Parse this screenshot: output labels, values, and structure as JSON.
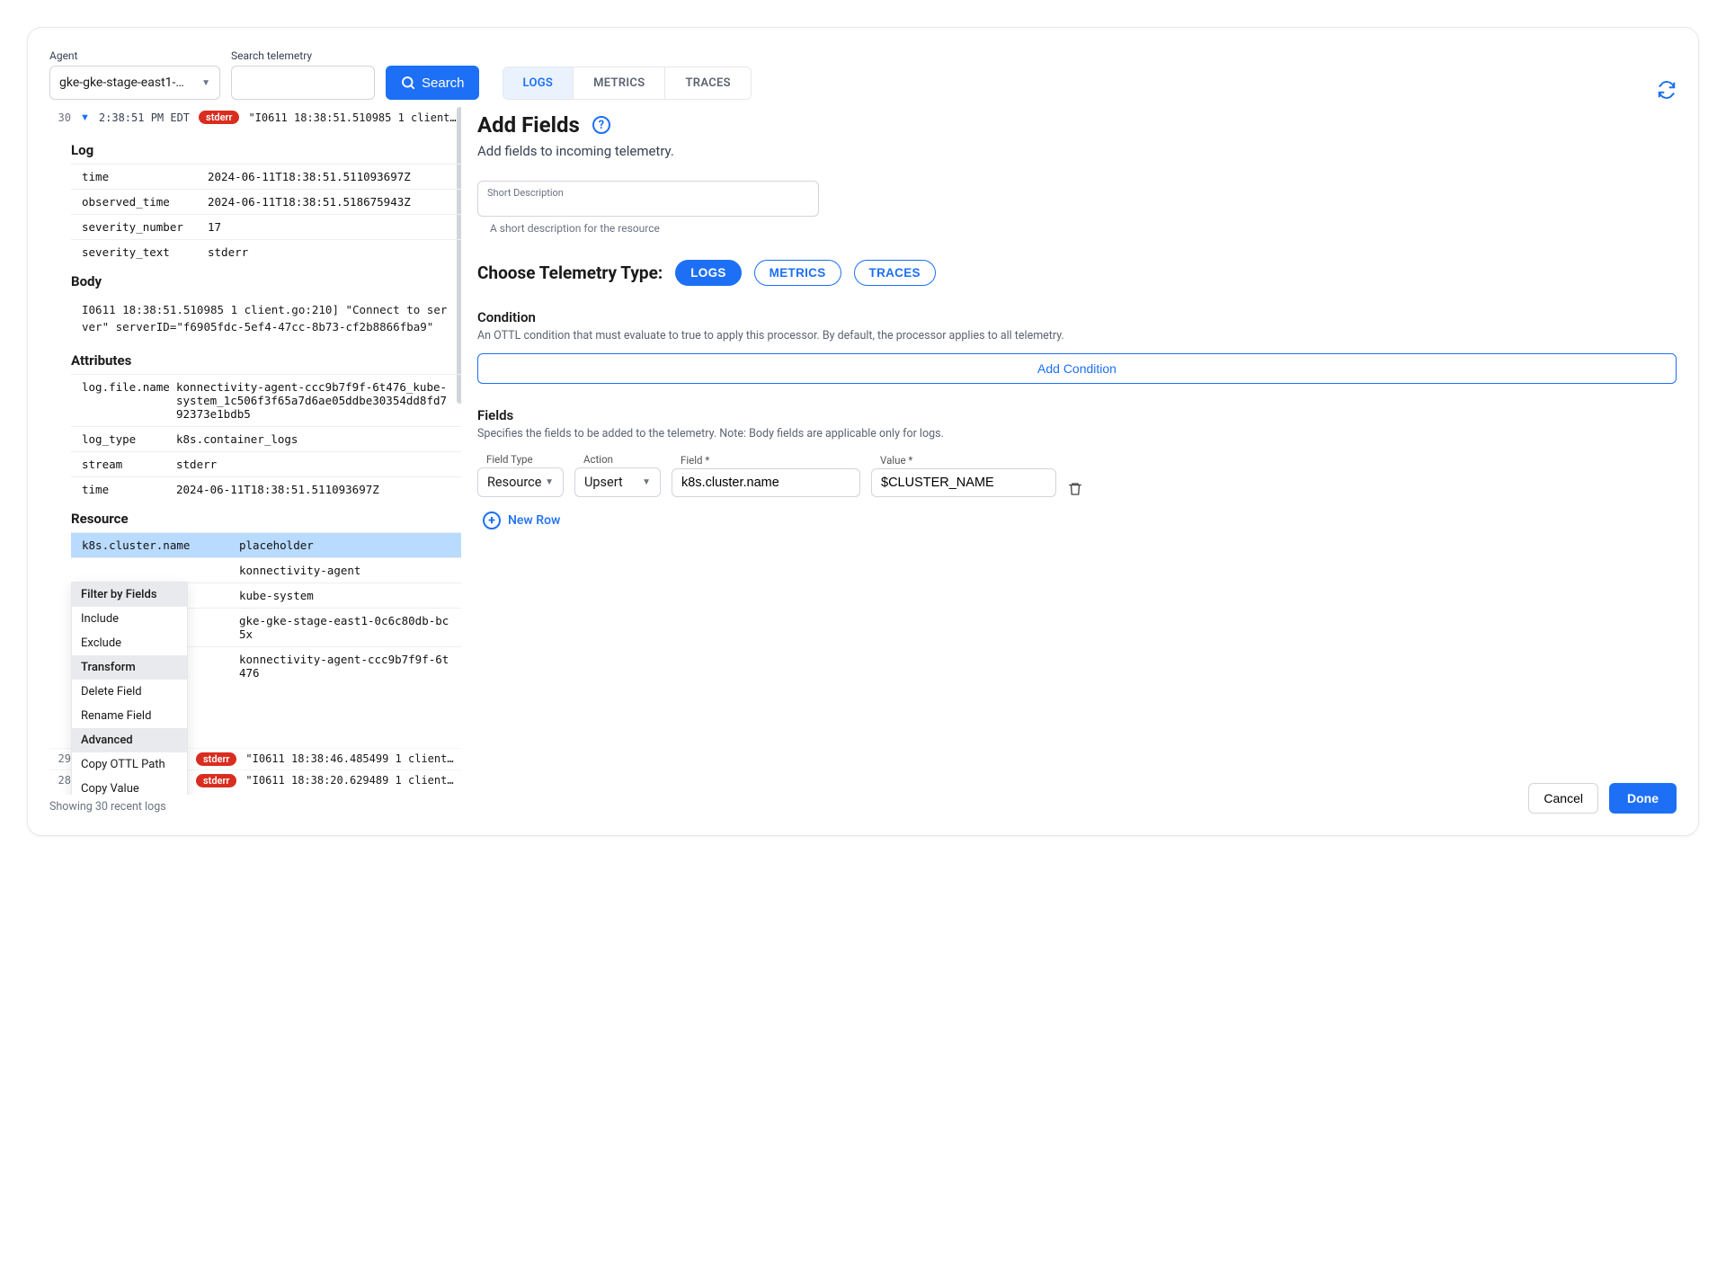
{
  "topbar": {
    "agent_label": "Agent",
    "agent_value": "gke-gke-stage-east1-…",
    "search_label": "Search telemetry",
    "search_value": "",
    "search_button": "Search",
    "tabs": {
      "logs": "LOGS",
      "metrics": "METRICS",
      "traces": "TRACES"
    }
  },
  "log_entry": {
    "index": "30",
    "timestamp": "2:38:51 PM EDT",
    "severity_pill": "stderr",
    "summary": "\"I0611 18:38:51.510985 1 client…",
    "sections": {
      "log_heading": "Log",
      "log": [
        {
          "k": "time",
          "v": "2024-06-11T18:38:51.511093697Z"
        },
        {
          "k": "observed_time",
          "v": "2024-06-11T18:38:51.518675943Z"
        },
        {
          "k": "severity_number",
          "v": "17"
        },
        {
          "k": "severity_text",
          "v": "stderr"
        }
      ],
      "body_heading": "Body",
      "body": "I0611 18:38:51.510985       1 client.go:210] \"Connect to server\" serverID=\"f6905fdc-5ef4-47cc-8b73-cf2b8866fba9\"",
      "attributes_heading": "Attributes",
      "attributes": [
        {
          "k": "log.file.name",
          "v": "konnectivity-agent-ccc9b7f9f-6t476_kube-system_1c506f3f65a7d6ae05ddbe30354dd8fd792373e1bdb5"
        },
        {
          "k": "log_type",
          "v": "k8s.container_logs"
        },
        {
          "k": "stream",
          "v": "stderr"
        },
        {
          "k": "time",
          "v": "2024-06-11T18:38:51.511093697Z"
        }
      ],
      "resource_heading": "Resource",
      "resource": [
        {
          "k": "k8s.cluster.name",
          "v": "placeholder",
          "highlight": true
        },
        {
          "k": "",
          "v": "konnectivity-agent"
        },
        {
          "k": "",
          "v": "kube-system"
        },
        {
          "k": "",
          "v": "gke-gke-stage-east1-0c6c80db-bc5x"
        },
        {
          "k": "",
          "v": "konnectivity-agent-ccc9b7f9f-6t476"
        }
      ]
    }
  },
  "context_menu": {
    "filter_heading": "Filter by Fields",
    "include": "Include",
    "exclude": "Exclude",
    "transform_heading": "Transform",
    "delete_field": "Delete Field",
    "rename_field": "Rename Field",
    "advanced_heading": "Advanced",
    "copy_ottl": "Copy OTTL Path",
    "copy_value": "Copy Value"
  },
  "collapsed_rows": [
    {
      "idx": "29",
      "pill": "stderr",
      "summary": "\"I0611 18:38:46.485499 1 client…"
    },
    {
      "idx": "28",
      "pill": "stderr",
      "summary": "\"I0611 18:38:20.629489 1 client…"
    }
  ],
  "status_bar": "Showing 30 recent logs",
  "right": {
    "title": "Add Fields",
    "subtitle": "Add fields to incoming telemetry.",
    "short_desc_label": "Short Description",
    "short_desc_hint": "A short description for the resource",
    "choose_type_label": "Choose Telemetry Type:",
    "type_pills": {
      "logs": "LOGS",
      "metrics": "METRICS",
      "traces": "TRACES"
    },
    "condition_heading": "Condition",
    "condition_desc": "An OTTL condition that must evaluate to true to apply this processor. By default, the processor applies to all telemetry.",
    "add_condition": "Add Condition",
    "fields_heading": "Fields",
    "fields_desc": "Specifies the fields to be added to the telemetry. Note: Body fields are applicable only for logs.",
    "row": {
      "field_type_label": "Field Type",
      "field_type_value": "Resource",
      "action_label": "Action",
      "action_value": "Upsert",
      "field_label": "Field *",
      "field_value": "k8s.cluster.name",
      "value_label": "Value *",
      "value_value": "$CLUSTER_NAME"
    },
    "new_row": "New Row",
    "cancel": "Cancel",
    "done": "Done"
  }
}
